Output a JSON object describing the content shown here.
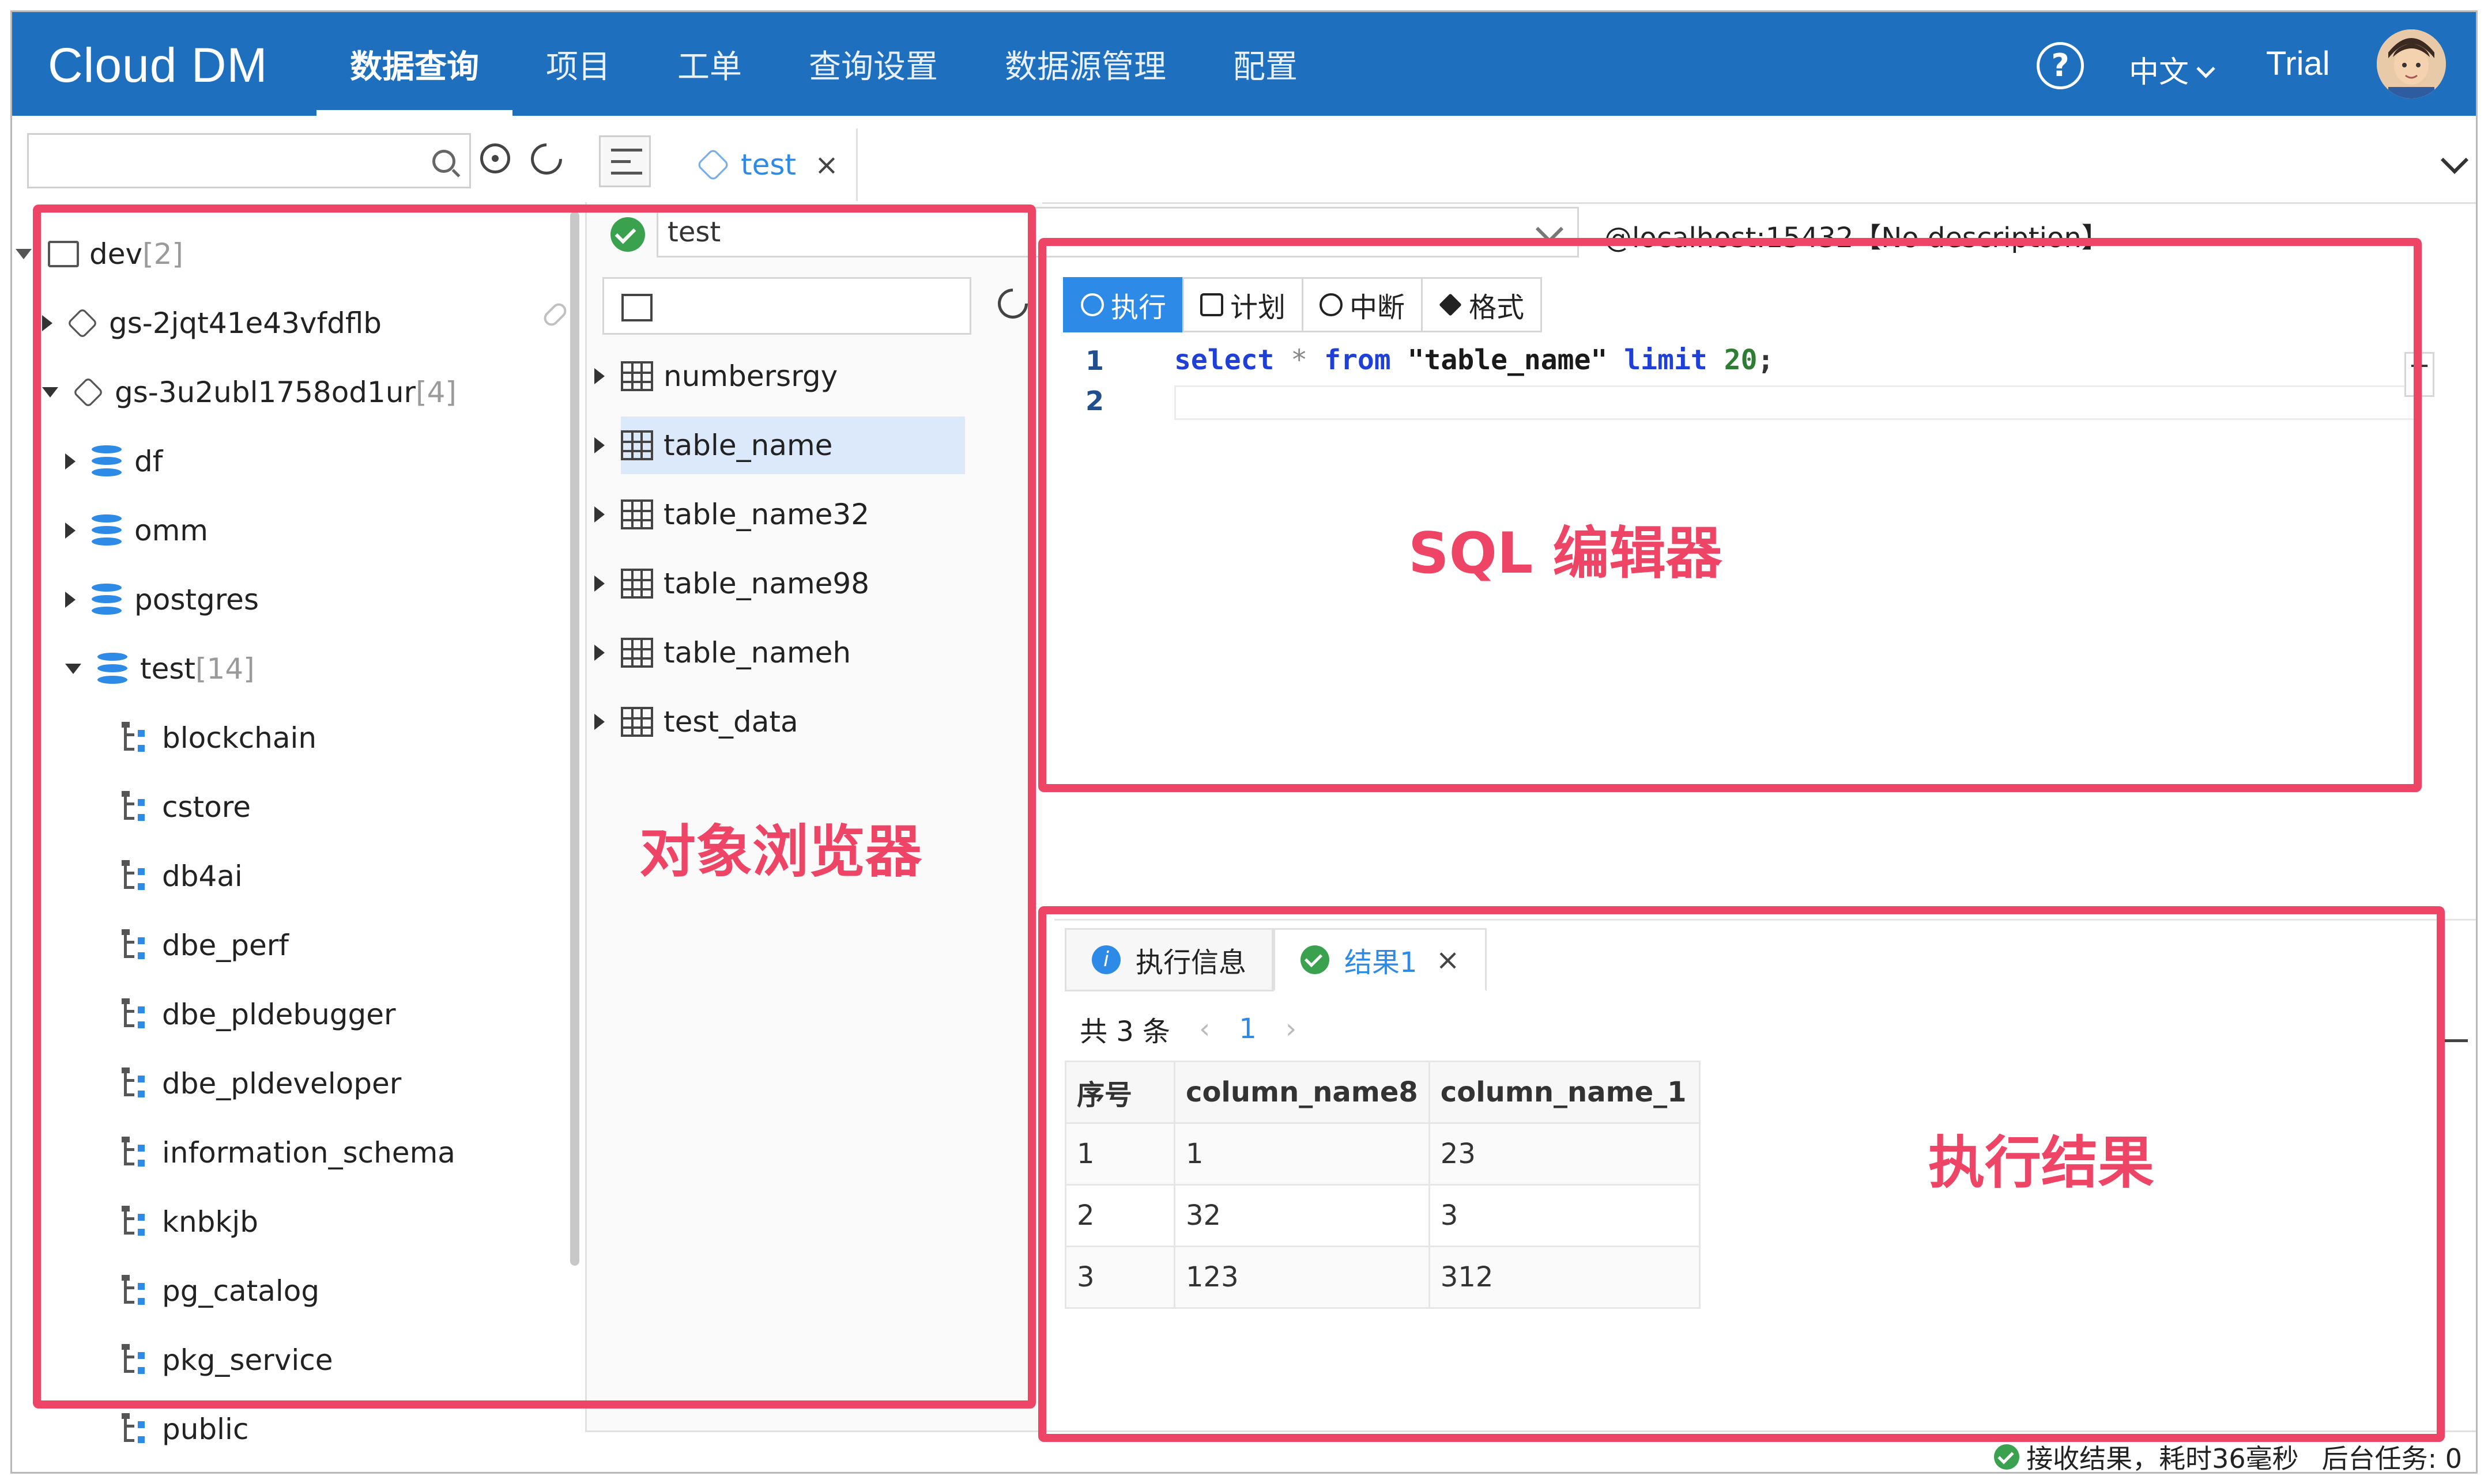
{
  "app": {
    "logo": "Cloud DM",
    "nav": [
      {
        "label": "数据查询",
        "active": true
      },
      {
        "label": "项目"
      },
      {
        "label": "工单"
      },
      {
        "label": "查询设置"
      },
      {
        "label": "数据源管理"
      },
      {
        "label": "配置"
      }
    ],
    "help_icon": "?",
    "language": "中文",
    "plan": "Trial"
  },
  "left_search": {
    "placeholder": "",
    "value": ""
  },
  "tree": {
    "nodes": [
      {
        "label": "dev",
        "count": "[2]",
        "expanded": true,
        "icon": "monitor-icon"
      },
      {
        "label": "gs-2jqt41e43vfdflb",
        "count": "",
        "expanded": false,
        "icon": "hex-icon"
      },
      {
        "label": "gs-3u2ubl1758od1ur",
        "count": "[4]",
        "expanded": true,
        "icon": "hex-icon"
      },
      {
        "label": "df",
        "count": "",
        "expanded": false,
        "icon": "database-icon"
      },
      {
        "label": "omm",
        "count": "",
        "expanded": false,
        "icon": "database-icon"
      },
      {
        "label": "postgres",
        "count": "",
        "expanded": false,
        "icon": "database-icon"
      },
      {
        "label": "test",
        "count": "[14]",
        "expanded": true,
        "icon": "database-icon"
      },
      {
        "label": "blockchain",
        "icon": "schema-icon"
      },
      {
        "label": "cstore",
        "icon": "schema-icon"
      },
      {
        "label": "db4ai",
        "icon": "schema-icon"
      },
      {
        "label": "dbe_perf",
        "icon": "schema-icon"
      },
      {
        "label": "dbe_pldebugger",
        "icon": "schema-icon"
      },
      {
        "label": "dbe_pldeveloper",
        "icon": "schema-icon"
      },
      {
        "label": "information_schema",
        "icon": "schema-icon"
      },
      {
        "label": "knbkjb",
        "icon": "schema-icon"
      },
      {
        "label": "pg_catalog",
        "icon": "schema-icon"
      },
      {
        "label": "pkg_service",
        "icon": "schema-icon"
      },
      {
        "label": "public",
        "icon": "schema-icon"
      }
    ]
  },
  "editor_tab": {
    "label": "test",
    "close": "×"
  },
  "connection": {
    "selected": "test",
    "description": "@localhost:15432【No description】"
  },
  "tables": {
    "items": [
      {
        "label": "numbersrgy"
      },
      {
        "label": "table_name",
        "selected": true
      },
      {
        "label": "table_name32"
      },
      {
        "label": "table_name98"
      },
      {
        "label": "table_nameh"
      },
      {
        "label": "test_data"
      }
    ]
  },
  "toolbar": {
    "run": "执行",
    "plan": "计划",
    "stop": "中断",
    "format": "格式"
  },
  "code": {
    "line_numbers": [
      "1",
      "2"
    ],
    "line1": {
      "kw1": "select",
      "star": " * ",
      "kw2": "from",
      "sp": " ",
      "str": "\"table_name\"",
      "sp2": " ",
      "kw3": "limit",
      "sp3": " ",
      "num": "20",
      "end": ";"
    },
    "t_button": "T"
  },
  "results": {
    "tabs": [
      {
        "label": "执行信息"
      },
      {
        "label": "结果1",
        "active": true
      }
    ],
    "close": "×",
    "total": "共 3 条",
    "page": "1",
    "prev": "‹",
    "next": "›",
    "columns": [
      "序号",
      "column_name8",
      "column_name_1"
    ],
    "rows": [
      [
        "1",
        "1",
        "23"
      ],
      [
        "2",
        "32",
        "3"
      ],
      [
        "3",
        "123",
        "312"
      ]
    ]
  },
  "status": {
    "message": "接收结果，耗时36毫秒",
    "tasks": "后台任务: 0"
  },
  "annotations": {
    "object_browser": "对象浏览器",
    "sql_editor": "SQL 编辑器",
    "result": "执行结果"
  },
  "colors": {
    "header": "#1f6fbf",
    "accent": "#2d8ae6",
    "annotation": "#ee4466",
    "success": "#3aa24f"
  }
}
